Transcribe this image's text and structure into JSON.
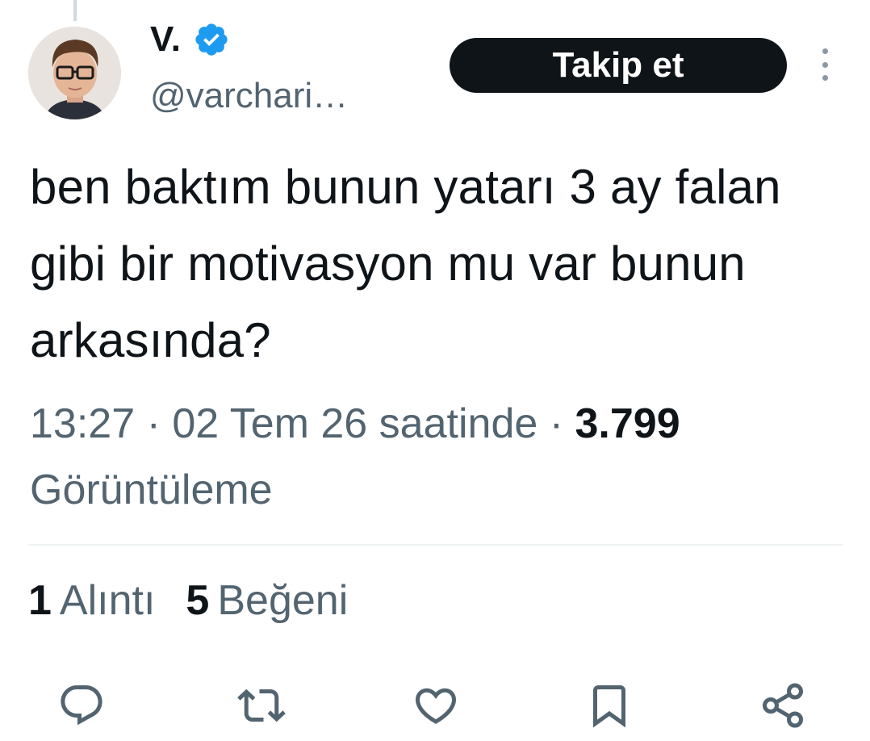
{
  "tweet": {
    "author": {
      "display_name": "V.",
      "handle": "@varchari…",
      "verified": true
    },
    "follow_label": "Takip et",
    "text": "ben baktım bunun yatarı 3 ay falan gibi bir motivasyon mu var bunun arkasında?",
    "meta": {
      "time": "13:27",
      "separator": " · ",
      "date": "02 Tem 26 saatinde",
      "views_count": "3.799",
      "views_label": "Görüntüleme"
    },
    "stats": {
      "quotes_count": "1",
      "quotes_label": "Alıntı",
      "likes_count": "5",
      "likes_label": "Beğeni"
    },
    "actions": [
      {
        "icon": "reply-icon"
      },
      {
        "icon": "retweet-icon"
      },
      {
        "icon": "like-icon"
      },
      {
        "icon": "bookmark-icon"
      },
      {
        "icon": "share-icon"
      }
    ]
  },
  "colors": {
    "text_primary": "#0f1419",
    "text_secondary": "#536471",
    "verified_blue": "#1d9bf0",
    "divider": "#eff3f4"
  }
}
